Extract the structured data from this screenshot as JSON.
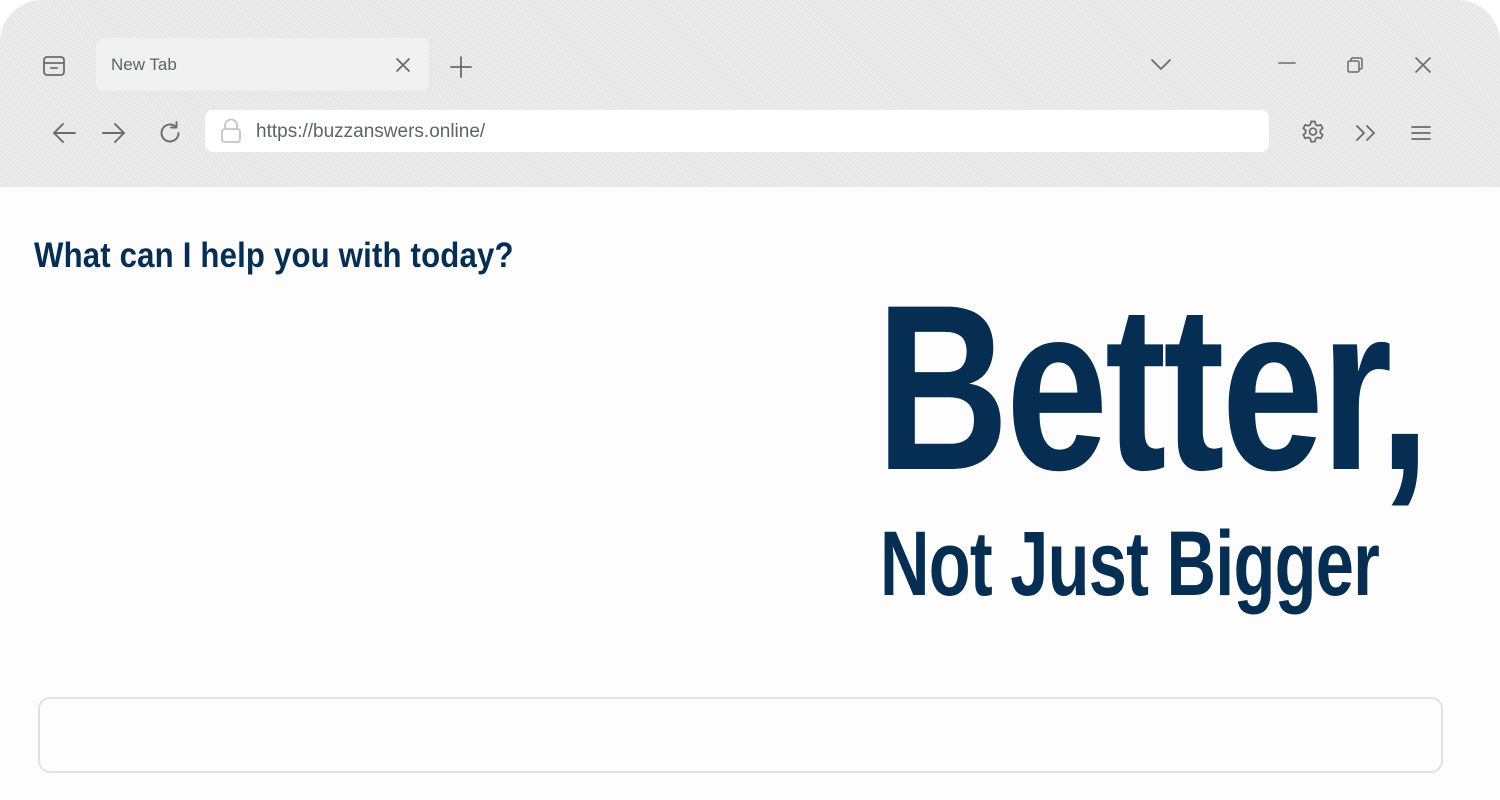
{
  "browser": {
    "tab": {
      "title": "New Tab"
    },
    "address_bar": {
      "url": "https://buzzanswers.online/"
    },
    "icons": {
      "tab_manager": "archive-box-icon",
      "tab_close": "close-icon",
      "new_tab": "plus-icon",
      "tab_list": "chevron-down-icon",
      "minimize": "minimize-icon",
      "restore": "restore-icon",
      "close_window": "close-icon",
      "back": "arrow-left-icon",
      "forward": "arrow-right-icon",
      "reload": "reload-icon",
      "lock": "lock-icon",
      "settings": "gear-icon",
      "extensions": "double-chevron-right-icon",
      "menu": "hamburger-menu-icon"
    }
  },
  "page": {
    "heading": "What can I help you with today?",
    "hero": {
      "line1": "Better,",
      "line2": "Not Just Bigger"
    },
    "chat_input": {
      "value": ""
    }
  },
  "colors": {
    "brand_navy": "#052e52",
    "chrome_bg": "#e6e6e6",
    "icon_gray": "#6b6b6b"
  }
}
